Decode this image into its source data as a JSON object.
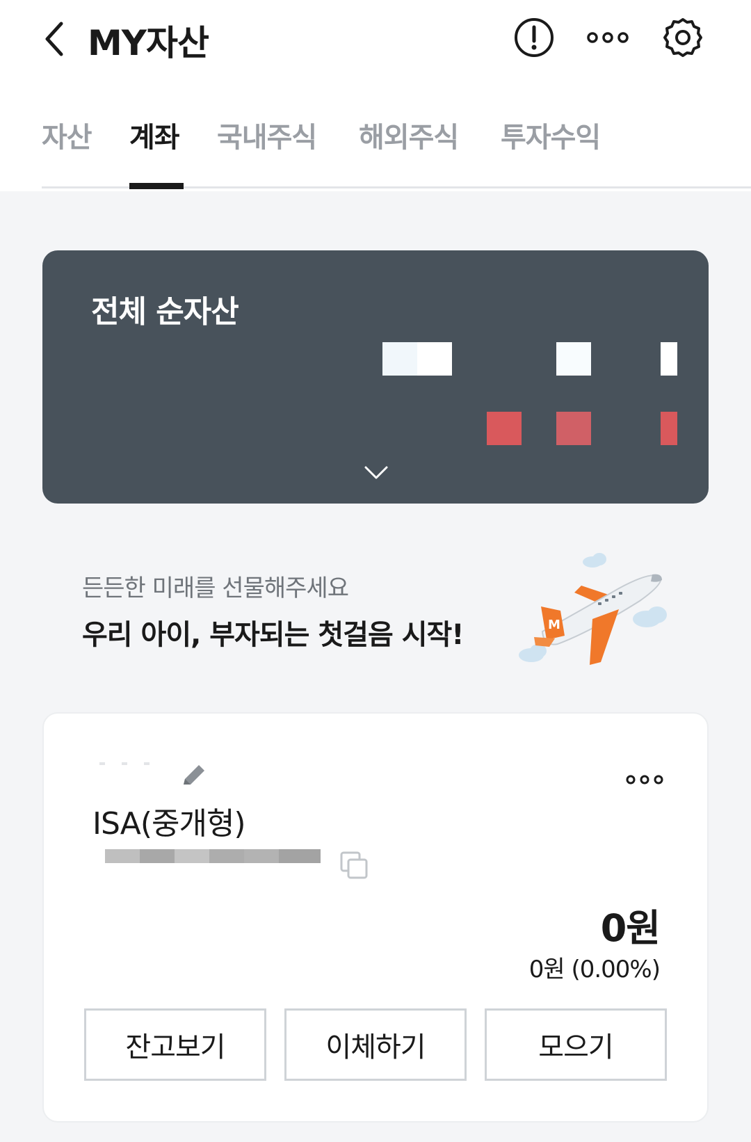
{
  "header": {
    "title": "MY자산",
    "icons": [
      "back-icon",
      "alert-icon",
      "more-icon",
      "settings-icon"
    ]
  },
  "tabs": [
    {
      "label": "자산",
      "active": false
    },
    {
      "label": "계좌",
      "active": true
    },
    {
      "label": "국내주식",
      "active": false
    },
    {
      "label": "해외주식",
      "active": false
    },
    {
      "label": "투자수익",
      "active": false
    }
  ],
  "net_assets": {
    "title": "전체 순자산",
    "value_hidden": true,
    "profit_hidden": true,
    "card_color": "#48525b",
    "profit_color": "#d9595c"
  },
  "promo": {
    "subtitle": "든든한 미래를 선물해주세요",
    "headline": "우리 아이, 부자되는 첫걸음 시작!"
  },
  "account": {
    "name": "ISA(중개형)",
    "balance": "0원",
    "profit": "0원 (0.00%)",
    "buttons": {
      "balance": "잔고보기",
      "transfer": "이체하기",
      "save": "모으기"
    }
  },
  "colors": {
    "accent_orange": "#f0782a",
    "text": "#1a1a1a",
    "muted_tab": "#9a9ea4"
  }
}
